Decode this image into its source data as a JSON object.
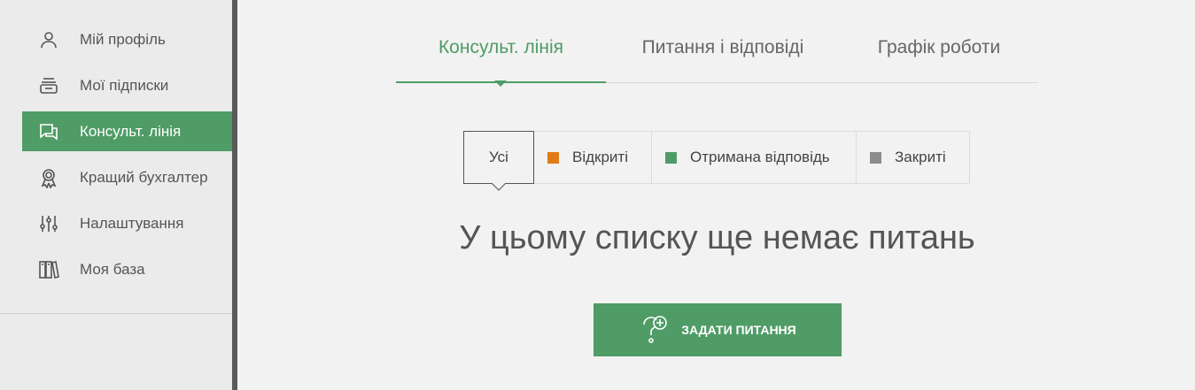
{
  "sidebar": {
    "items": [
      {
        "label": "Мій профіль",
        "icon": "user-icon"
      },
      {
        "label": "Мої підписки",
        "icon": "subscriptions-icon"
      },
      {
        "label": "Консульт. лінія",
        "icon": "chat-icon",
        "active": true
      },
      {
        "label": "Кращий бухгалтер",
        "icon": "award-icon"
      },
      {
        "label": "Налаштування",
        "icon": "sliders-icon"
      },
      {
        "label": "Моя база",
        "icon": "books-icon"
      }
    ]
  },
  "tabs": [
    {
      "label": "Консульт. лінія",
      "active": true
    },
    {
      "label": "Питання і відповіді"
    },
    {
      "label": "Графік роботи"
    }
  ],
  "filters": [
    {
      "label": "Усі",
      "selected": true
    },
    {
      "label": "Відкриті",
      "color": "#e07b1a"
    },
    {
      "label": "Отримана відповідь",
      "color": "#4f9c66"
    },
    {
      "label": "Закриті",
      "color": "#8c8c8c"
    }
  ],
  "empty_message": "У цьому списку ще немає питань",
  "ask_button": {
    "label": "ЗАДАТИ ПИТАННЯ",
    "icon": "question-plus-icon"
  },
  "colors": {
    "accent": "#4f9c66",
    "open": "#e07b1a",
    "answered": "#4f9c66",
    "closed": "#8c8c8c"
  }
}
